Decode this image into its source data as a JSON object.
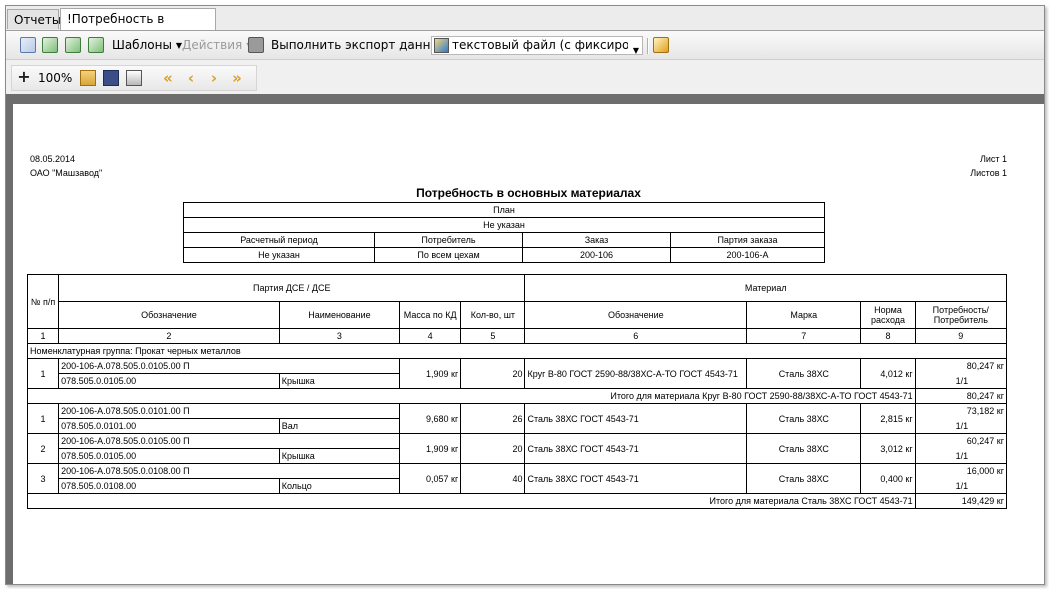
{
  "tabs": [
    "Отчеты",
    "!Потребность в материалах"
  ],
  "toolbar": {
    "templates_label": "Шаблоны",
    "actions_label": "Действия",
    "export_label": "Выполнить экспорт данных в:",
    "export_format": "текстовый файл (с фиксированным"
  },
  "viewer": {
    "zoom": "100%"
  },
  "report": {
    "date": "08.05.2014",
    "org": "ОАО \"Машзавод\"",
    "sheet": "Лист 1",
    "sheets": "Листов 1",
    "title": "Потребность в основных материалах",
    "plan": {
      "plan_label": "План",
      "plan_value": "Не указан",
      "headers": [
        "Расчетный период",
        "Потребитель",
        "Заказ",
        "Партия заказа"
      ],
      "values": [
        "Не указан",
        "По всем цехам",
        "200-106",
        "200-106-А"
      ]
    },
    "table": {
      "h_num": "№ п/п",
      "h_party": "Партия ДСЕ / ДСЕ",
      "h_designation": "Обозначение",
      "h_name": "Наименование",
      "h_mass": "Масса по КД",
      "h_qty": "Кол-во, шт",
      "h_material": "Материал",
      "h_mat_designation": "Обозначение",
      "h_grade": "Марка",
      "h_norm": "Норма расхода",
      "h_need": "Потребность/ Потребитель",
      "col_nums": [
        "1",
        "2",
        "3",
        "4",
        "5",
        "6",
        "7",
        "8",
        "9"
      ],
      "group": "Номенклатурная группа: Прокат черных металлов",
      "rows1": [
        {
          "n": "1",
          "party": "200-106-А.078.505.0.0105.00 П",
          "dce": "078.505.0.0105.00",
          "name": "Крышка",
          "mass": "1,909 кг",
          "qty": "20",
          "material": "Круг В-80 ГОСТ 2590-88/38ХС-А-ТО ГОСТ 4543-71",
          "grade": "Сталь 38ХС",
          "norm": "4,012 кг",
          "need": "80,247 кг",
          "cons": "1/1"
        }
      ],
      "total1_label": "Итого для материала Круг В-80 ГОСТ 2590-88/38ХС-А-ТО ГОСТ 4543-71",
      "total1_value": "80,247 кг",
      "rows2": [
        {
          "n": "1",
          "party": "200-106-А.078.505.0.0101.00 П",
          "dce": "078.505.0.0101.00",
          "name": "Вал",
          "mass": "9,680 кг",
          "qty": "26",
          "material": "Сталь 38ХС ГОСТ 4543-71",
          "grade": "Сталь 38ХС",
          "norm": "2,815 кг",
          "need": "73,182 кг",
          "cons": "1/1"
        },
        {
          "n": "2",
          "party": "200-106-А.078.505.0.0105.00 П",
          "dce": "078.505.0.0105.00",
          "name": "Крышка",
          "mass": "1,909 кг",
          "qty": "20",
          "material": "Сталь 38ХС ГОСТ 4543-71",
          "grade": "Сталь 38ХС",
          "norm": "3,012 кг",
          "need": "60,247 кг",
          "cons": "1/1"
        },
        {
          "n": "3",
          "party": "200-106-А.078.505.0.0108.00 П",
          "dce": "078.505.0.0108.00",
          "name": "Кольцо",
          "mass": "0,057 кг",
          "qty": "40",
          "material": "Сталь 38ХС ГОСТ 4543-71",
          "grade": "Сталь 38ХС",
          "norm": "0,400 кг",
          "need": "16,000 кг",
          "cons": "1/1"
        }
      ],
      "total2_label": "Итого для материала Сталь 38ХС ГОСТ 4543-71",
      "total2_value": "149,429 кг"
    }
  }
}
